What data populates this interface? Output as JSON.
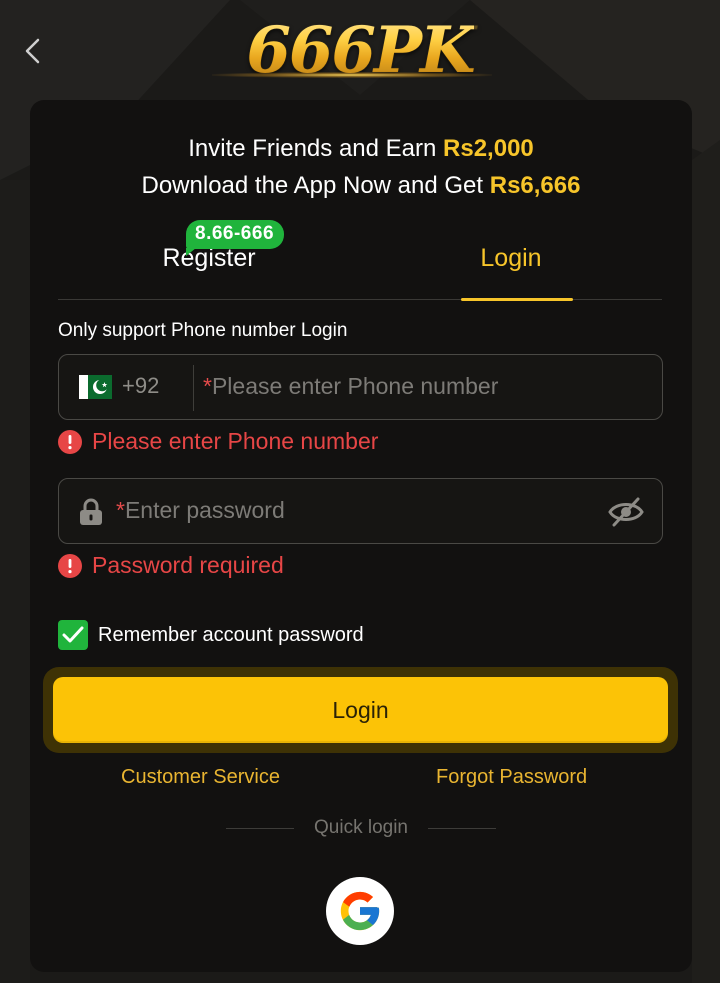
{
  "header": {
    "back_icon": "chevron-left-icon",
    "logo_text": "666PK"
  },
  "promo": {
    "line1_prefix": "Invite Friends and Earn ",
    "line1_amount": "Rs2,000",
    "line2_prefix": "Download the App Now and Get ",
    "line2_amount": "Rs6,666"
  },
  "tabs": {
    "register_label": "Register",
    "register_badge": "8.66-666",
    "login_label": "Login",
    "active": "Login"
  },
  "form": {
    "hint": "Only support Phone number Login",
    "phone": {
      "country_code": "+92",
      "flag_icon": "pakistan-flag-icon",
      "required_mark": "*",
      "placeholder": "Please enter Phone number",
      "value": "",
      "error": "Please enter Phone number"
    },
    "password": {
      "required_mark": "*",
      "placeholder": "Enter password",
      "value": "",
      "error": "Password required",
      "toggle_icon": "eye-off-icon"
    },
    "remember_label": "Remember account password",
    "remember_checked": true,
    "submit_label": "Login"
  },
  "links": {
    "customer_service": "Customer Service",
    "forgot_password": "Forgot Password"
  },
  "quick_login": {
    "label": "Quick login",
    "providers": [
      "google-icon"
    ]
  },
  "colors": {
    "accent_gold": "#f7c52a",
    "button_yellow": "#fcc306",
    "success_green": "#20b43c",
    "error_red": "#e74646",
    "card_bg": "#121110"
  }
}
